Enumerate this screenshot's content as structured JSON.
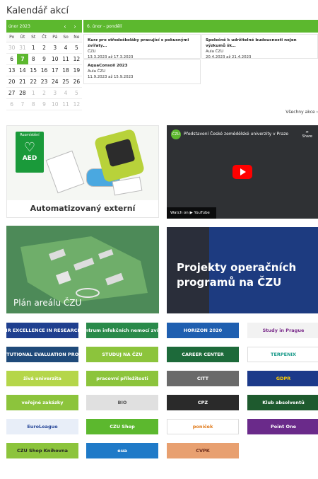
{
  "title": "Kalendář akcí",
  "calendar": {
    "month": "únor 2023",
    "prev": "‹",
    "next": "›",
    "days": [
      "Po",
      "Út",
      "St",
      "Čt",
      "Pá",
      "So",
      "Ne"
    ],
    "weeks": [
      [
        "30",
        "31",
        "1",
        "2",
        "3",
        "4",
        "5"
      ],
      [
        "6",
        "7",
        "8",
        "9",
        "10",
        "11",
        "12"
      ],
      [
        "13",
        "14",
        "15",
        "16",
        "17",
        "18",
        "19"
      ],
      [
        "20",
        "21",
        "22",
        "23",
        "24",
        "25",
        "26"
      ],
      [
        "27",
        "28",
        "1",
        "2",
        "3",
        "4",
        "5"
      ],
      [
        "6",
        "7",
        "8",
        "9",
        "10",
        "11",
        "12"
      ]
    ],
    "other_month": [
      [
        0,
        1
      ],
      [
        0,
        2
      ],
      [
        4,
        3
      ],
      [
        4,
        4
      ],
      [
        4,
        5
      ],
      [
        4,
        6
      ],
      [
        4,
        7
      ],
      [
        5,
        1
      ],
      [
        5,
        2
      ],
      [
        5,
        3
      ],
      [
        5,
        4
      ],
      [
        5,
        5
      ],
      [
        5,
        6
      ],
      [
        5,
        7
      ]
    ],
    "today": [
      1,
      1
    ]
  },
  "events": {
    "header": "6. únor - pondělí",
    "items": [
      {
        "title": "Kurz pro středoškoláky pracující s pokusnými zvířaty…",
        "place": "ČZU",
        "dates": "13.3.2023 až 17.3.2023"
      },
      {
        "title": "Společně k udržitelné budoucnosti nejen výzkumů šk…",
        "place": "Aula ČZU",
        "dates": "20.4.2023 až 21.4.2023"
      },
      {
        "title": "AquaConsoil 2023",
        "place": "Aula ČZU",
        "dates": "11.9.2023 až 15.9.2023"
      }
    ],
    "all": "Všechny akce ›"
  },
  "tiles": {
    "aed_caption": "Automatizovaný externí defibrilátor",
    "aed_sign_top": "Rozmístění",
    "aed_sign_label": "AED",
    "video_title": "Představení České zemědělské univerzity v Praze",
    "video_share": "Share",
    "video_watch": "Watch on ▶ YouTube",
    "map_caption": "Plán areálu ČZU",
    "proj_caption": "Projekty operačních programů na ČZU"
  },
  "logos": [
    {
      "label": "HR EXCELLENCE IN RESEARCH",
      "bg": "#1f3f8f",
      "fg": "#fff"
    },
    {
      "label": "Centrum infekčních nemocí zvířat",
      "bg": "#2a8a4a",
      "fg": "#fff"
    },
    {
      "label": "HORIZON 2020",
      "bg": "#1f5fb0",
      "fg": "#fff"
    },
    {
      "label": "Study in Prague",
      "bg": "#f2f2f2",
      "fg": "#7a2a8a"
    },
    {
      "label": "IEP INSTITUTIONAL EVALUATION PROGRAMME",
      "bg": "#1f4a7a",
      "fg": "#fff"
    },
    {
      "label": "STUDUJ NA ČZU",
      "bg": "#8cc43c",
      "fg": "#fff"
    },
    {
      "label": "CAREER CENTER",
      "bg": "#1d6a3a",
      "fg": "#fff"
    },
    {
      "label": "TERPENIX",
      "bg": "#fff",
      "fg": "#1a9a8a"
    },
    {
      "label": "živá univerzita",
      "bg": "#b5d64a",
      "fg": "#fff"
    },
    {
      "label": "pracovní příležitosti",
      "bg": "#8cc43c",
      "fg": "#fff"
    },
    {
      "label": "CITT",
      "bg": "#6a6a6a",
      "fg": "#fff"
    },
    {
      "label": "GDPR",
      "bg": "#1c3a8a",
      "fg": "#ffcc00"
    },
    {
      "label": "veřejné zakázky",
      "bg": "#8cc43c",
      "fg": "#fff"
    },
    {
      "label": "BIO",
      "bg": "#e0e0e0",
      "fg": "#555"
    },
    {
      "label": "CPZ",
      "bg": "#2a2a2a",
      "fg": "#fff"
    },
    {
      "label": "Klub absolventů",
      "bg": "#1e5a2e",
      "fg": "#fff"
    },
    {
      "label": "EuroLeague",
      "bg": "#e8eef8",
      "fg": "#2a4a9a"
    },
    {
      "label": "CZU Shop",
      "bg": "#5cb82e",
      "fg": "#fff"
    },
    {
      "label": "poníček",
      "bg": "#fff",
      "fg": "#e07a1a"
    },
    {
      "label": "Point One",
      "bg": "#6a2a8a",
      "fg": "#fff"
    },
    {
      "label": "CZU Shop Knihovna",
      "bg": "#8cc43c",
      "fg": "#222"
    },
    {
      "label": "eua",
      "bg": "#1f7ac8",
      "fg": "#fff"
    },
    {
      "label": "CVPK",
      "bg": "#e8a070",
      "fg": "#6a2a1a"
    }
  ]
}
